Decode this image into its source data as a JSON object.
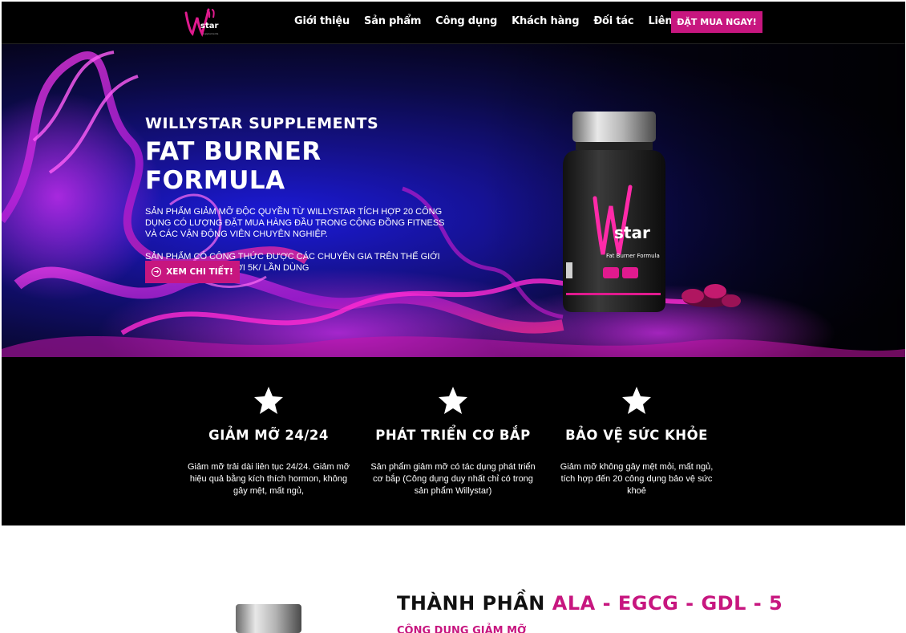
{
  "header": {
    "logo_text": "Willy star",
    "nav": [
      "Giới thiệu",
      "Sản phẩm",
      "Công dụng",
      "Khách hàng",
      "Đối tác",
      "Liên hệ"
    ],
    "order_button": "ĐẶT MUA NGAY!"
  },
  "hero": {
    "brand": "WILLYSTAR SUPPLEMENTS",
    "title": "FAT BURNER FORMULA",
    "desc1": "Sản phẩm giảm mỡ độc quyền từ Willystar tích hợp 20 công dụng có lượng đặt mua hàng đầu trong cộng đồng fitness và các vận động viên chuyên nghiệp.",
    "desc2": "Sản phẩm có công thức được các chuyên gia trên thế giới đánh giá cao chỉ với 5k/ lần dùng",
    "detail_button": "XEM CHI TIẾT!",
    "bottle_label": "Fat Burner Formula"
  },
  "features": [
    {
      "icon": "star-icon",
      "title": "GIẢM MỠ 24/24",
      "text": "Giảm mỡ trải dài liên tục 24/24. Giảm mỡ hiệu quả bằng kích thích hormon, không gây mệt, mất ngủ,"
    },
    {
      "icon": "star-icon",
      "title": "PHÁT TRIỂN CƠ BẮP",
      "text": "Sản phẩm giảm mỡ có tác dụng phát triển cơ bắp (Công dụng duy nhất chỉ có trong sản phẩm Willystar)"
    },
    {
      "icon": "star-icon",
      "title": "BẢO VỆ SỨC KHỎE",
      "text": "Giảm mỡ không gây mệt mỏi, mất ngủ, tích hợp đến 20 công dụng bảo vệ sức khoẻ"
    }
  ],
  "ingredients": {
    "title_dark": "THÀNH PHẦN",
    "title_pink": "ALA - EGCG - GDL - 5",
    "subtitle": "CÔNG DỤNG GIẢM MỠ"
  },
  "colors": {
    "accent": "#c7167f",
    "dark": "#000000"
  }
}
